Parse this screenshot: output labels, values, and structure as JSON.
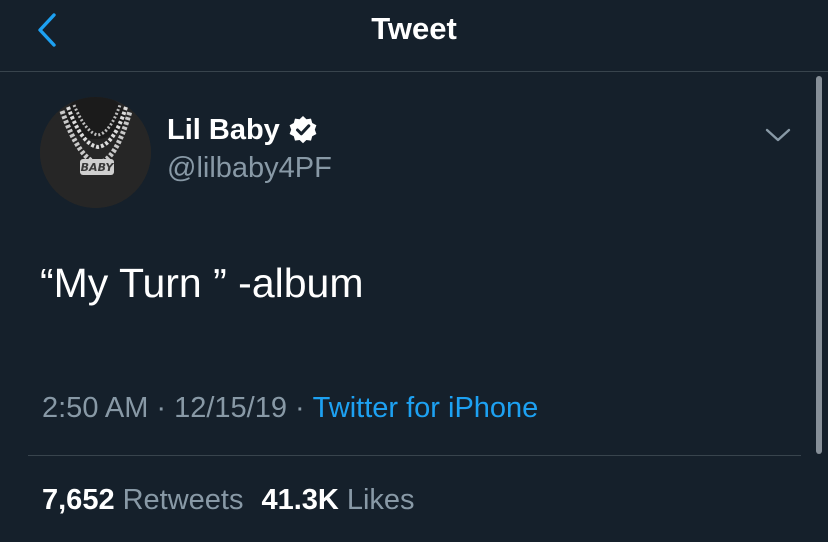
{
  "header": {
    "title": "Tweet"
  },
  "author": {
    "display_name": "Lil Baby",
    "handle": "@lilbaby4PF",
    "verified": true,
    "avatar_pendant_text": "BABY"
  },
  "tweet": {
    "text": "“My Turn ” -album",
    "time": "2:50 AM",
    "date": "12/15/19",
    "source": "Twitter for iPhone"
  },
  "stats": {
    "retweets_count": "7,652",
    "retweets_label": "Retweets",
    "likes_count": "41.3K",
    "likes_label": "Likes"
  },
  "colors": {
    "background": "#15202b",
    "accent": "#1da1f2",
    "secondary_text": "#8899a6",
    "divider": "#38444d"
  },
  "icons": {
    "back": "chevron-left-icon",
    "verified": "verified-badge-icon",
    "more": "chevron-down-icon"
  }
}
